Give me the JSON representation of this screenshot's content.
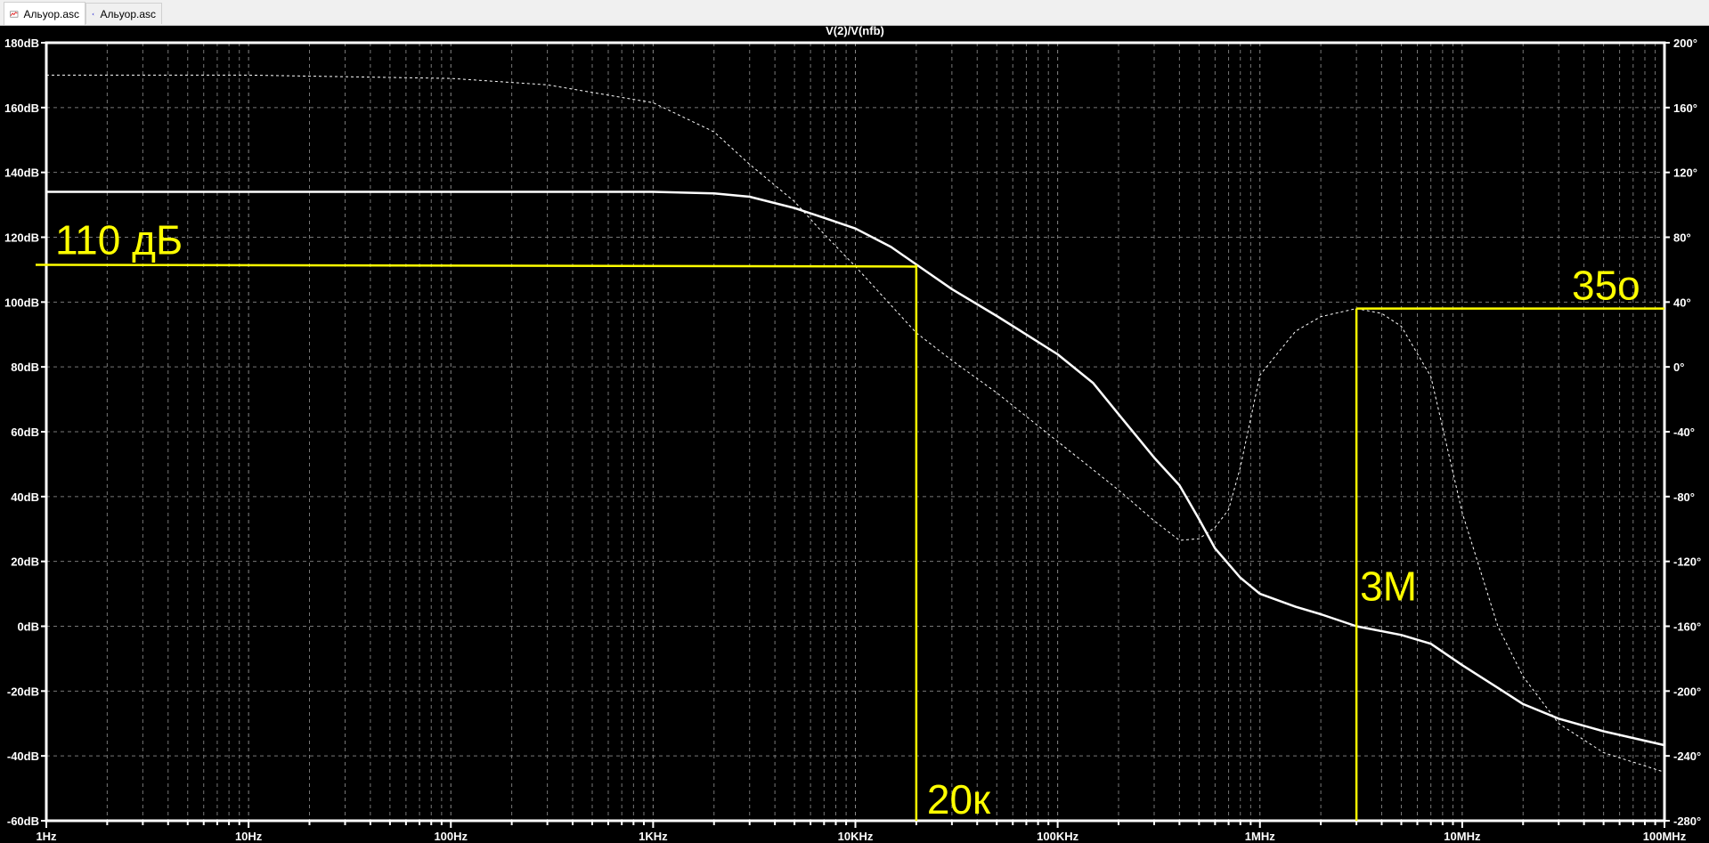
{
  "tabs": [
    {
      "label": "Альуор.asc",
      "icon": "waveform-icon",
      "active": true
    },
    {
      "label": "Альуор.asc",
      "icon": "schematic-transistor-icon",
      "active": false
    }
  ],
  "chart_data": {
    "type": "line",
    "title": "V(2)/V(nfb)",
    "xscale": "log",
    "xlim": [
      1,
      100000000
    ],
    "x_ticks": [
      "1Hz",
      "10Hz",
      "100Hz",
      "1KHz",
      "10KHz",
      "100KHz",
      "1MHz",
      "10MHz",
      "100MHz"
    ],
    "ylim_left": [
      -60,
      180
    ],
    "y_left_ticks": [
      "180dB",
      "160dB",
      "140dB",
      "120dB",
      "100dB",
      "80dB",
      "60dB",
      "40dB",
      "20dB",
      "0dB",
      "-20dB",
      "-40dB",
      "-60dB"
    ],
    "ylim_right": [
      -280,
      200
    ],
    "y_right_ticks": [
      "200°",
      "160°",
      "120°",
      "80°",
      "40°",
      "0°",
      "-40°",
      "-80°",
      "-120°",
      "-160°",
      "-200°",
      "-240°",
      "-280°"
    ],
    "grid": true,
    "series": [
      {
        "name": "magnitude",
        "axis": "left",
        "style": "solid",
        "color": "#ffffff",
        "points": [
          [
            1,
            134
          ],
          [
            100,
            134
          ],
          [
            1000,
            134
          ],
          [
            2000,
            133.5
          ],
          [
            3000,
            132.5
          ],
          [
            5000,
            129
          ],
          [
            7000,
            126
          ],
          [
            10000,
            122.7
          ],
          [
            15000,
            117
          ],
          [
            20000,
            111.6
          ],
          [
            30000,
            104
          ],
          [
            50000,
            95.7
          ],
          [
            70000,
            90
          ],
          [
            100000,
            83.9
          ],
          [
            150000,
            75
          ],
          [
            200000,
            65.4
          ],
          [
            300000,
            52
          ],
          [
            400000,
            43.5
          ],
          [
            500000,
            33
          ],
          [
            600000,
            24
          ],
          [
            800000,
            15
          ],
          [
            1000000,
            10
          ],
          [
            1500000,
            6
          ],
          [
            2000000,
            3.7
          ],
          [
            3000000,
            0
          ],
          [
            5000000,
            -2.7
          ],
          [
            7000000,
            -5.4
          ],
          [
            10000000,
            -12
          ],
          [
            15000000,
            -19
          ],
          [
            20000000,
            -24
          ],
          [
            30000000,
            -28.5
          ],
          [
            50000000,
            -32.4
          ],
          [
            100000000,
            -36.7
          ]
        ]
      },
      {
        "name": "phase",
        "axis": "right",
        "style": "dashed",
        "color": "#ffffff",
        "points": [
          [
            1,
            180
          ],
          [
            10,
            180
          ],
          [
            100,
            178
          ],
          [
            300,
            174
          ],
          [
            1000,
            163
          ],
          [
            2000,
            145
          ],
          [
            3000,
            125
          ],
          [
            5000,
            102
          ],
          [
            7000,
            82
          ],
          [
            10000,
            62
          ],
          [
            15000,
            38
          ],
          [
            20000,
            21
          ],
          [
            30000,
            4
          ],
          [
            50000,
            -16
          ],
          [
            100000,
            -46
          ],
          [
            200000,
            -76
          ],
          [
            300000,
            -95
          ],
          [
            400000,
            -107
          ],
          [
            500000,
            -106
          ],
          [
            600000,
            -99
          ],
          [
            700000,
            -88
          ],
          [
            800000,
            -62
          ],
          [
            1000000,
            -5
          ],
          [
            1500000,
            22
          ],
          [
            2000000,
            31
          ],
          [
            3000000,
            36
          ],
          [
            4000000,
            33
          ],
          [
            5000000,
            25
          ],
          [
            7000000,
            -6
          ],
          [
            10000000,
            -90
          ],
          [
            15000000,
            -160
          ],
          [
            20000000,
            -191
          ],
          [
            30000000,
            -220
          ],
          [
            50000000,
            -238
          ],
          [
            100000000,
            -250
          ]
        ]
      }
    ],
    "annotations": [
      {
        "text": "110 дБ",
        "color": "#ffff00",
        "hline_db": 111.5,
        "to_freq": 20000,
        "vline_freq": 20000
      },
      {
        "text": "20к",
        "color": "#ffff00"
      },
      {
        "text": "3M",
        "color": "#ffff00",
        "vline_freq": 3000000,
        "hline_deg": 36
      },
      {
        "text": "35о",
        "color": "#ffff00"
      }
    ]
  }
}
